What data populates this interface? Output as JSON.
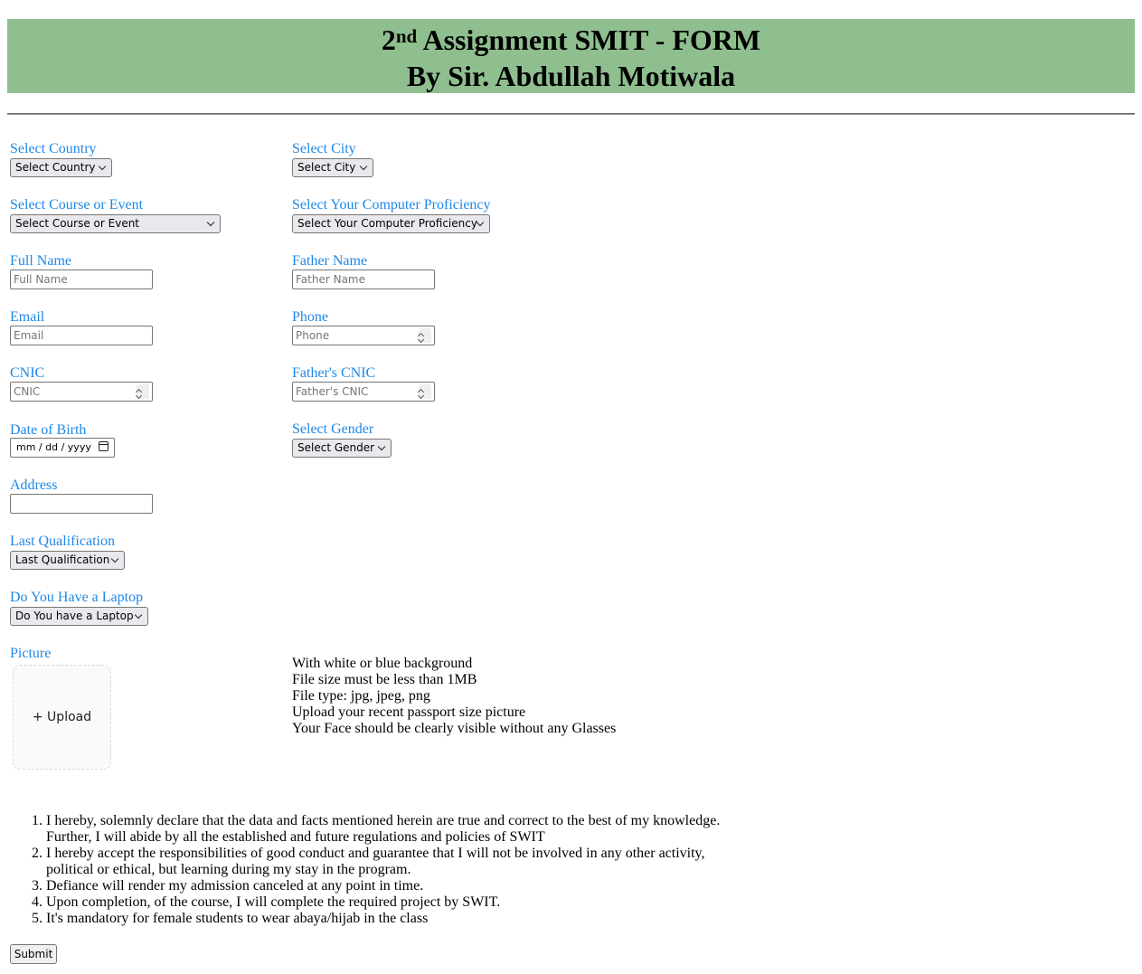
{
  "header": {
    "title_num": "2",
    "title_sup": "nd",
    "title_rest": " Assignment SMIT - FORM",
    "subtitle": "By Sir. Abdullah Motiwala"
  },
  "form": {
    "country": {
      "label": "Select Country",
      "value": "Select Country"
    },
    "city": {
      "label": "Select City",
      "value": "Select City"
    },
    "course": {
      "label": "Select Course or Event",
      "value": "Select Course or Event"
    },
    "proficiency": {
      "label": "Select Your Computer Proficiency",
      "value": "Select Your Computer Proficiency"
    },
    "full_name": {
      "label": "Full Name",
      "placeholder": "Full Name"
    },
    "father_name": {
      "label": "Father Name",
      "placeholder": "Father Name"
    },
    "email": {
      "label": "Email",
      "placeholder": "Email"
    },
    "phone": {
      "label": "Phone",
      "placeholder": "Phone"
    },
    "cnic": {
      "label": "CNIC",
      "placeholder": "CNIC"
    },
    "father_cnic": {
      "label": "Father's CNIC",
      "placeholder": "Father's CNIC"
    },
    "dob": {
      "label": "Date of Birth",
      "value": "mm / dd / yyyy"
    },
    "gender": {
      "label": "Select Gender",
      "value": "Select Gender"
    },
    "address": {
      "label": "Address",
      "value": ""
    },
    "qualification": {
      "label": "Last Qualification",
      "value": "Last Qualification"
    },
    "laptop": {
      "label": "Do You Have a Laptop",
      "value": "Do You have a Laptop"
    },
    "picture": {
      "label": "Picture",
      "upload_label": "+ Upload"
    }
  },
  "picture_notes": [
    "With white or blue background",
    "File size must be less than 1MB",
    "File type: jpg, jpeg, png",
    "Upload your recent passport size picture",
    "Your Face should be clearly visible without any Glasses"
  ],
  "terms": [
    "I hereby, solemnly declare that the data and facts mentioned herein are true and correct to the best of my knowledge. Further, I will abide by all the established and future regulations and policies of SWIT",
    "I hereby accept the responsibilities of good conduct and guarantee that I will not be involved in any other activity, political or ethical, but learning during my stay in the program.",
    "Defiance will render my admission canceled at any point in time.",
    "Upon completion, of the course, I will complete the required project by SWIT.",
    "It's mandatory for female students to wear abaya/hijab in the class"
  ],
  "submit_label": "Submit",
  "colors": {
    "banner": "#8fbf8f",
    "label": "#1e88e5"
  }
}
